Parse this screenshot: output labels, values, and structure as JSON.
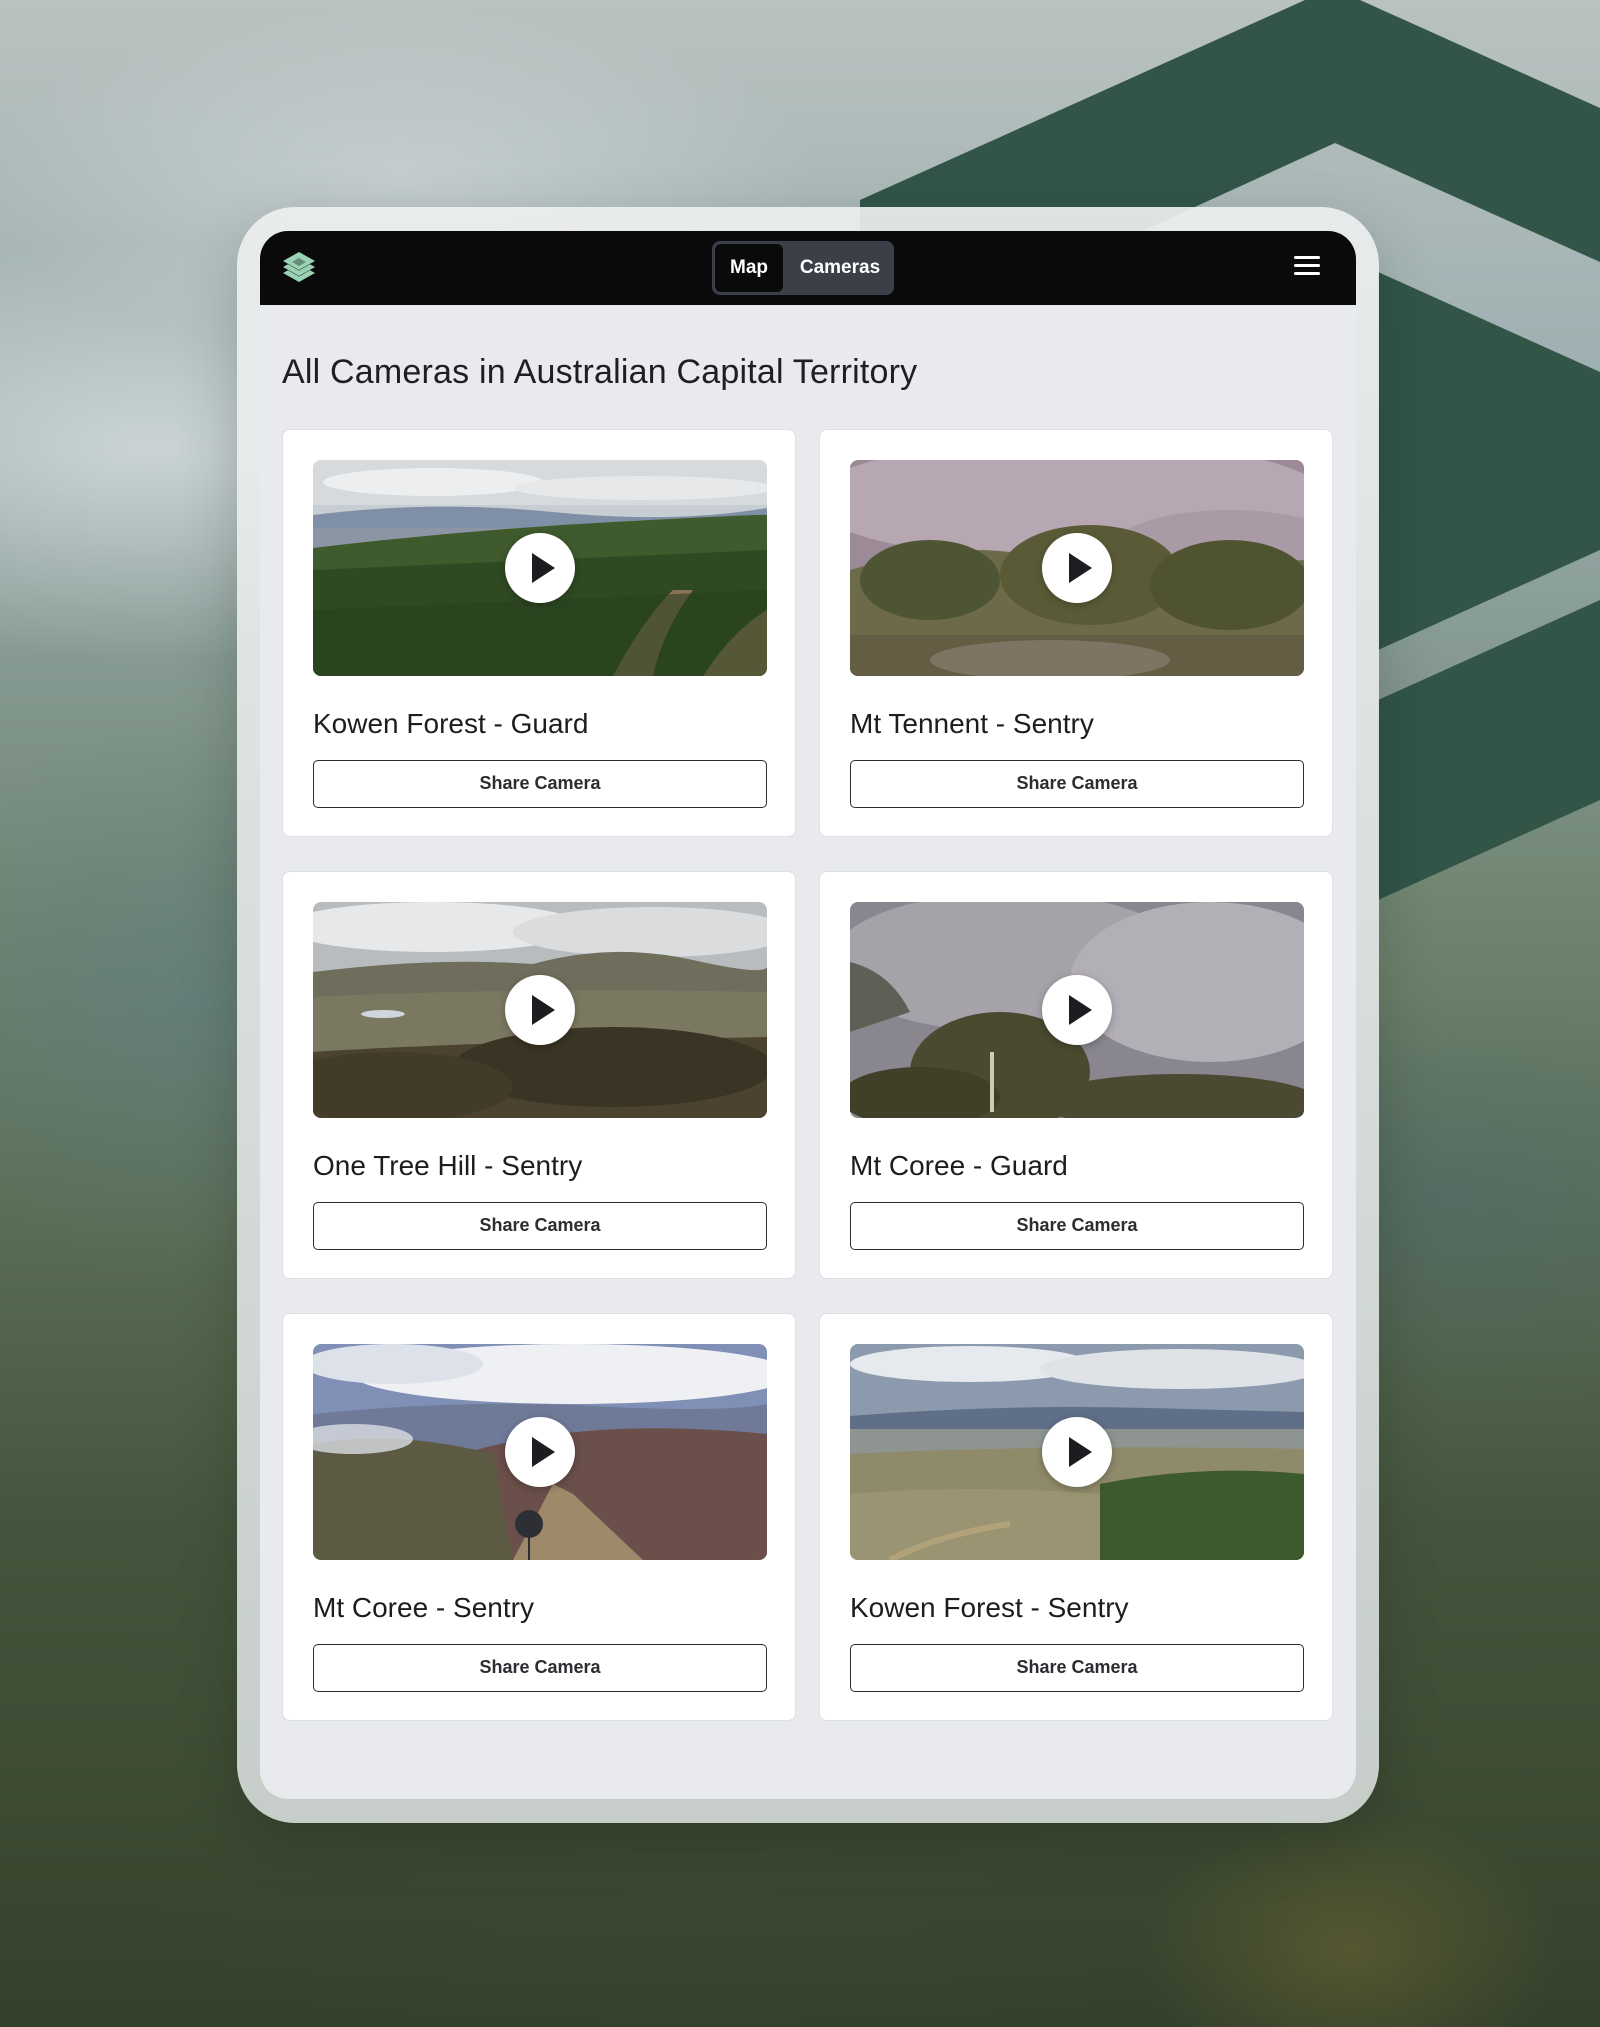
{
  "colors": {
    "brand_green": "#325548",
    "logo_green": "#9ad3b3",
    "topbar": "#0b0a0b",
    "screen_bg": "#e8eaed"
  },
  "header": {
    "logo_icon": "stacked-layers-logo",
    "tabs": [
      {
        "label": "Map",
        "selected": true
      },
      {
        "label": "Cameras",
        "selected": false
      }
    ],
    "menu_icon": "hamburger-menu-icon"
  },
  "page": {
    "title": "All Cameras in Australian Capital Territory"
  },
  "cameras": [
    {
      "name": "Kowen Forest - Guard",
      "share_label": "Share Camera",
      "play_icon": "play-icon"
    },
    {
      "name": "Mt Tennent - Sentry",
      "share_label": "Share Camera",
      "play_icon": "play-icon"
    },
    {
      "name": "One Tree Hill - Sentry",
      "share_label": "Share Camera",
      "play_icon": "play-icon"
    },
    {
      "name": "Mt Coree - Guard",
      "share_label": "Share Camera",
      "play_icon": "play-icon"
    },
    {
      "name": "Mt Coree - Sentry",
      "share_label": "Share Camera",
      "play_icon": "play-icon"
    },
    {
      "name": "Kowen Forest - Sentry",
      "share_label": "Share Camera",
      "play_icon": "play-icon"
    }
  ]
}
